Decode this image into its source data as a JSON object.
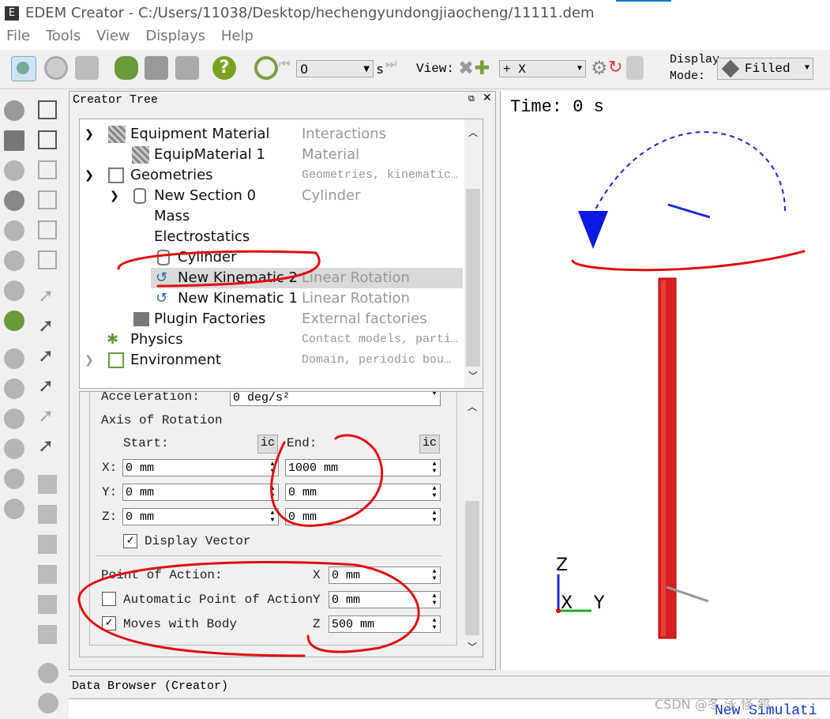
{
  "window": {
    "title": "EDEM Creator - C:/Users/11038/Desktop/hechengyundongjiaocheng/11111.dem"
  },
  "menu": [
    "File",
    "Tools",
    "View",
    "Displays",
    "Help"
  ],
  "toolbar": {
    "time_value": "0",
    "time_unit": "s",
    "view_label": "View:",
    "view_value": "+ X",
    "display_mode_label_1": "Display",
    "display_mode_label_2": "Mode:",
    "display_mode_value": "Filled",
    "help_icon": "question-icon"
  },
  "creator_tree": {
    "title": "Creator Tree",
    "rows": [
      {
        "name": "Equipment Material",
        "desc": "Interactions"
      },
      {
        "name": "EquipMaterial 1",
        "desc": "Material"
      },
      {
        "name": "Geometries",
        "desc": "Geometries, kinematic…"
      },
      {
        "name": "New Section 0",
        "desc": "Cylinder"
      },
      {
        "name": "Mass",
        "desc": ""
      },
      {
        "name": "Electrostatics",
        "desc": ""
      },
      {
        "name": "Cylinder",
        "desc": ""
      },
      {
        "name": "New Kinematic 2",
        "desc": "Linear Rotation"
      },
      {
        "name": "New Kinematic 1",
        "desc": "Linear Rotation"
      },
      {
        "name": "Plugin Factories",
        "desc": "External factories"
      },
      {
        "name": "Physics",
        "desc": "Contact models, parti…"
      },
      {
        "name": "Environment",
        "desc": "Domain, periodic bou…"
      }
    ]
  },
  "properties": {
    "acceleration_label": "Acceleration:",
    "acceleration_value": "0 deg/s²",
    "axis_label": "Axis of Rotation",
    "start_label": "Start:",
    "end_label": "End:",
    "ic_label": "ic",
    "start": {
      "x": "0 mm",
      "y": "0 mm",
      "z": "0 mm"
    },
    "end": {
      "x": "1000 mm",
      "y": "0 mm",
      "z": "0 mm"
    },
    "axis_x": "X:",
    "axis_y": "Y:",
    "axis_z": "Z:",
    "display_vector": "Display Vector",
    "display_vector_checked": true,
    "point_of_action_label": "Point of Action:",
    "automatic_point": "Automatic Point of Action",
    "automatic_point_checked": false,
    "moves_with_body": "Moves with Body",
    "moves_with_body_checked": true,
    "poa": {
      "x": "0 mm",
      "y": "0 mm",
      "z": "500 mm"
    },
    "poa_x": "X",
    "poa_y": "Y",
    "poa_z": "Z"
  },
  "viewport": {
    "time_text": "Time: 0 s",
    "axis_z": "Z",
    "axis_x": "X",
    "axis_y": "Y"
  },
  "data_browser": {
    "title": "Data Browser (Creator)",
    "partial_text": "New Simulati"
  },
  "watermark": "CSDN @冬 泳 怪 鸽"
}
